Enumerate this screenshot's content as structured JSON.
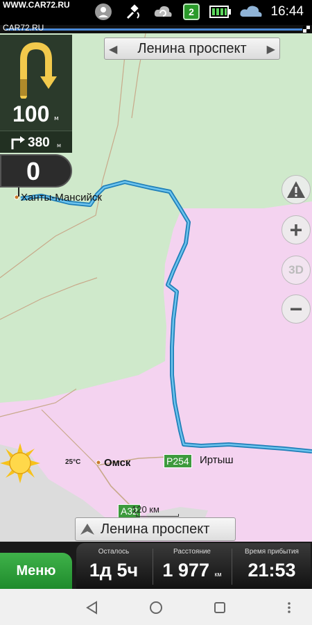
{
  "status_bar": {
    "watermark": "WWW.CAR72.RU",
    "watermark2": "CAR72.RU",
    "notification_count": "2",
    "time": "16:44",
    "icons": [
      "gps-pin-icon",
      "satellite-icon",
      "sync-cloud-icon",
      "battery-icon",
      "weather-cloud-icon"
    ]
  },
  "navigation": {
    "next_street": "Ленина проспект",
    "turn": {
      "type": "u-turn",
      "distance": "100",
      "unit": "м"
    },
    "next_turn": {
      "type": "right",
      "distance": "380",
      "unit": "м"
    },
    "speed": "0",
    "current_street": "Ленина проспект"
  },
  "map": {
    "cities": [
      {
        "name": "Ханты-Мансийск"
      },
      {
        "name": "Омск"
      },
      {
        "name": "Иртыш"
      }
    ],
    "roads": [
      "Р254",
      "А32"
    ],
    "weather_temp": "25°C",
    "scale": "120 км",
    "buttons": {
      "warning": "!",
      "zoom_in": "+",
      "view_3d": "3D",
      "zoom_out": "−"
    }
  },
  "bottom_bar": {
    "menu_label": "Меню",
    "remaining_label": "Осталось",
    "remaining_value": "1д 5ч",
    "distance_label": "Расстояние",
    "distance_value": "1 977",
    "distance_unit": "км",
    "arrival_label": "Время прибытия",
    "arrival_value": "21:53"
  }
}
